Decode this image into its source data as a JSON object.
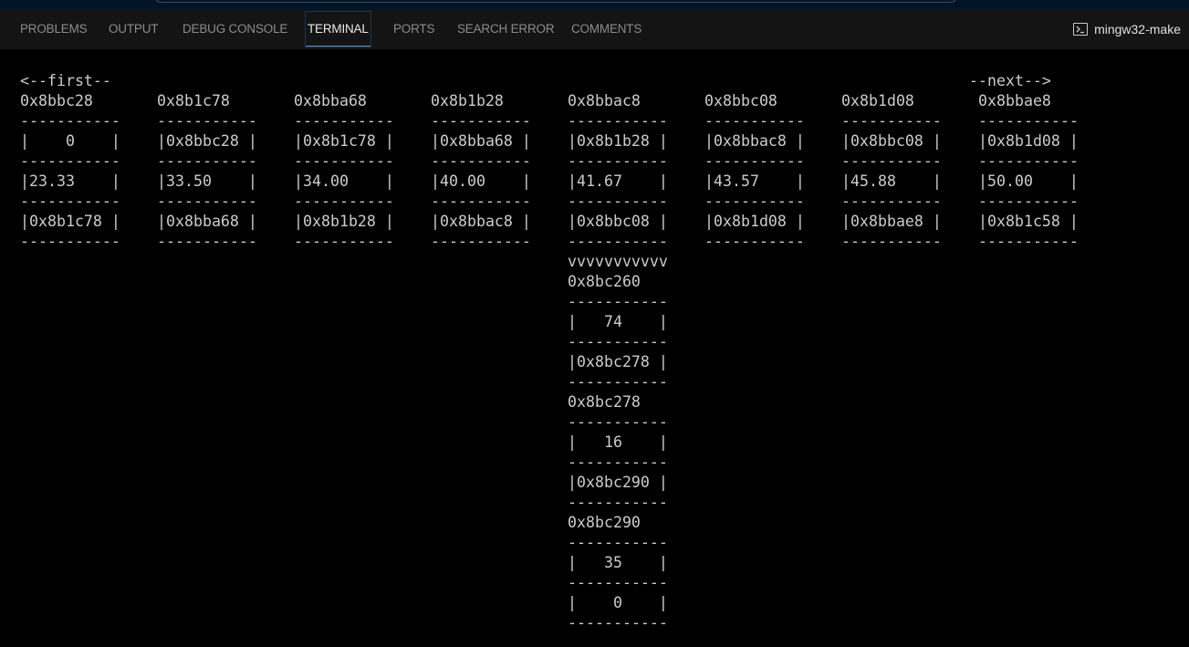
{
  "tabs": [
    {
      "label": "PROBLEMS",
      "active": false
    },
    {
      "label": "OUTPUT",
      "active": false
    },
    {
      "label": "DEBUG CONSOLE",
      "active": false
    },
    {
      "label": "TERMINAL",
      "active": true
    },
    {
      "label": "PORTS",
      "active": false
    },
    {
      "label": "SEARCH ERROR",
      "active": false
    },
    {
      "label": "COMMENTS",
      "active": false
    }
  ],
  "terminal_instance": {
    "icon": "terminal-icon",
    "label": "mingw32-make"
  },
  "colors": {
    "titlebar": "#021526",
    "panel_tabs_bg": "#141414",
    "terminal_bg": "#000000",
    "terminal_fg": "#cccccc",
    "active_tab_underline": "#6b8bb0"
  },
  "terminal": {
    "first_label": "<--first--",
    "next_label": "--next-->",
    "separator": "-----------",
    "nodes": [
      {
        "address": "0x8bbc28",
        "rows": [
          "|    0    |",
          "|23.33    |",
          "|0x8b1c78 |"
        ]
      },
      {
        "address": "0x8b1c78",
        "rows": [
          "|0x8bbc28 |",
          "|33.50    |",
          "|0x8bba68 |"
        ]
      },
      {
        "address": "0x8bba68",
        "rows": [
          "|0x8b1c78 |",
          "|34.00    |",
          "|0x8b1b28 |"
        ]
      },
      {
        "address": "0x8b1b28",
        "rows": [
          "|0x8bba68 |",
          "|40.00    |",
          "|0x8bbac8 |"
        ]
      },
      {
        "address": "0x8bbac8",
        "rows": [
          "|0x8b1b28 |",
          "|41.67    |",
          "|0x8bbc08 |"
        ]
      },
      {
        "address": "0x8bbc08",
        "rows": [
          "|0x8bbac8 |",
          "|43.57    |",
          "|0x8b1d08 |"
        ]
      },
      {
        "address": "0x8b1d08",
        "rows": [
          "|0x8bbc08 |",
          "|45.88    |",
          "|0x8bbae8 |"
        ]
      },
      {
        "address": "0x8bbae8",
        "rows": [
          "|0x8b1d08 |",
          "|50.00    |",
          "|0x8b1c58 |"
        ]
      }
    ],
    "down_arrow": "vvvvvvvvvvv",
    "sublist": [
      {
        "address": "0x8bc260",
        "rows": [
          "|   74    |",
          "|0x8bc278 |"
        ]
      },
      {
        "address": "0x8bc278",
        "rows": [
          "|   16    |",
          "|0x8bc290 |"
        ]
      },
      {
        "address": "0x8bc290",
        "rows": [
          "|   35    |",
          "|    0    |"
        ]
      }
    ]
  }
}
